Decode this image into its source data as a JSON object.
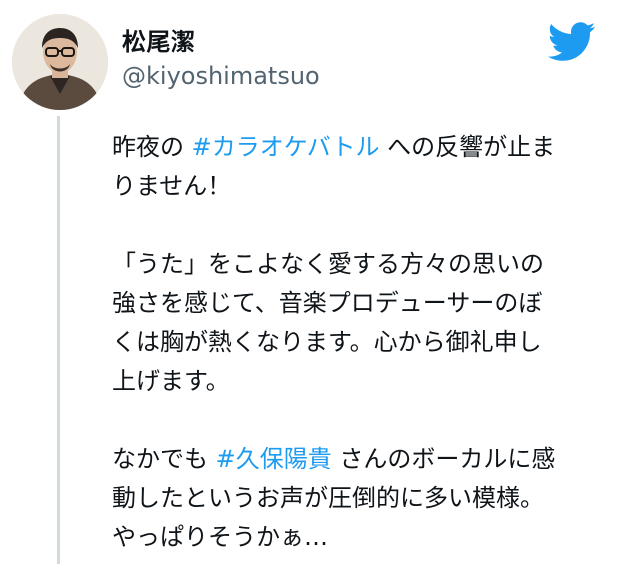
{
  "author": {
    "display_name": "松尾潔",
    "handle": "@kiyoshimatsuo"
  },
  "icons": {
    "brand": "twitter-bird-icon",
    "brand_color": "#1d9bf0",
    "link_color": "#1d9bf0",
    "thread_line_color": "#cfd9de"
  },
  "tweet": {
    "p1": {
      "l1_before": "昨夜の ",
      "l1_hashtag": "#カラオケバトル",
      "l1_after": " への反響が止ま",
      "l2": "りません！"
    },
    "p2": {
      "l1": "「うた」をこよなく愛する方々の思いの",
      "l2": "強さを感じて、音楽プロデューサーのぼ",
      "l3": "くは胸が熱くなります。心から御礼申し",
      "l4": "上げます。"
    },
    "p3": {
      "l1_before": "なかでも ",
      "l1_hashtag": "#久保陽貴",
      "l1_after": " さんのボーカルに感",
      "l2": "動したというお声が圧倒的に多い模様。",
      "l3": "やっぱりそうかぁ…"
    }
  }
}
